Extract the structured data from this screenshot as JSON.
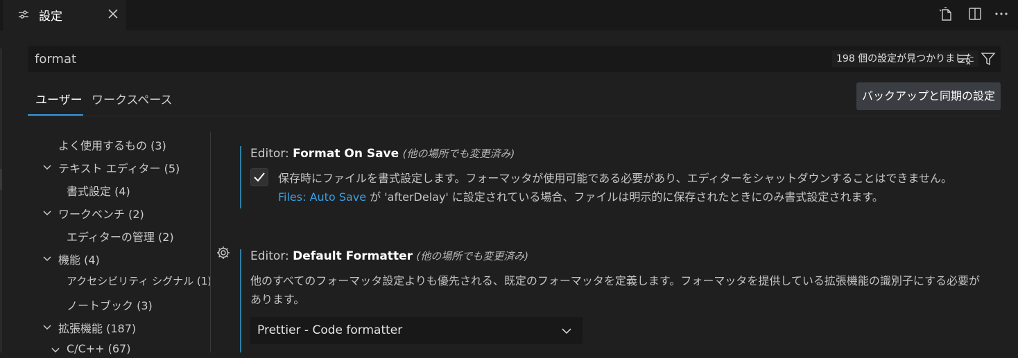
{
  "tab": {
    "title": "設定"
  },
  "search": {
    "value": "format",
    "result_count": "198 個の設定が見つかりました"
  },
  "scope_tabs": [
    {
      "label": "ユーザー",
      "active": true
    },
    {
      "label": "ワークスペース",
      "active": false
    }
  ],
  "sync_button": "バックアップと同期の設定",
  "toc": [
    {
      "label": "よく使用するもの (3)",
      "expanded": null,
      "level": 0
    },
    {
      "label": "テキスト エディター (5)",
      "expanded": true,
      "level": 0
    },
    {
      "label": "書式設定 (4)",
      "expanded": null,
      "level": 1
    },
    {
      "label": "ワークベンチ (2)",
      "expanded": true,
      "level": 0
    },
    {
      "label": "エディターの管理 (2)",
      "expanded": null,
      "level": 1
    },
    {
      "label": "機能 (4)",
      "expanded": true,
      "level": 0
    },
    {
      "label": "アクセシビリティ シグナル (1)",
      "expanded": null,
      "level": 1
    },
    {
      "label": "ノートブック (3)",
      "expanded": null,
      "level": 1
    },
    {
      "label": "拡張機能 (187)",
      "expanded": true,
      "level": 0
    },
    {
      "label": "C/C++ (67)",
      "expanded": true,
      "level": 1
    }
  ],
  "settings": {
    "format_on_save": {
      "category": "Editor: ",
      "name": "Format On Save",
      "modified": "(他の場所でも変更済み)",
      "checked": true,
      "desc_a": "保存時にファイルを書式設定します。フォーマッタが使用可能である必要があり、エディターをシャットダウンすることはできません。",
      "link_a": "Files:",
      "link_b": "Auto Save",
      "desc_b": " が 'afterDelay' に設定されている場合、ファイルは明示的に保存されたときにのみ書式設定されます。"
    },
    "default_formatter": {
      "category": "Editor: ",
      "name": "Default Formatter",
      "modified": "(他の場所でも変更済み)",
      "desc": "他のすべてのフォーマッタ設定よりも優先される、既定のフォーマッタを定義します。フォーマッタを提供している拡張機能の識別子にする必要があります。",
      "value": "Prettier - Code formatter"
    }
  },
  "colors": {
    "accent": "#3a96dd",
    "link": "#3b9fe0",
    "setting_bar": "#2f7fa5"
  }
}
